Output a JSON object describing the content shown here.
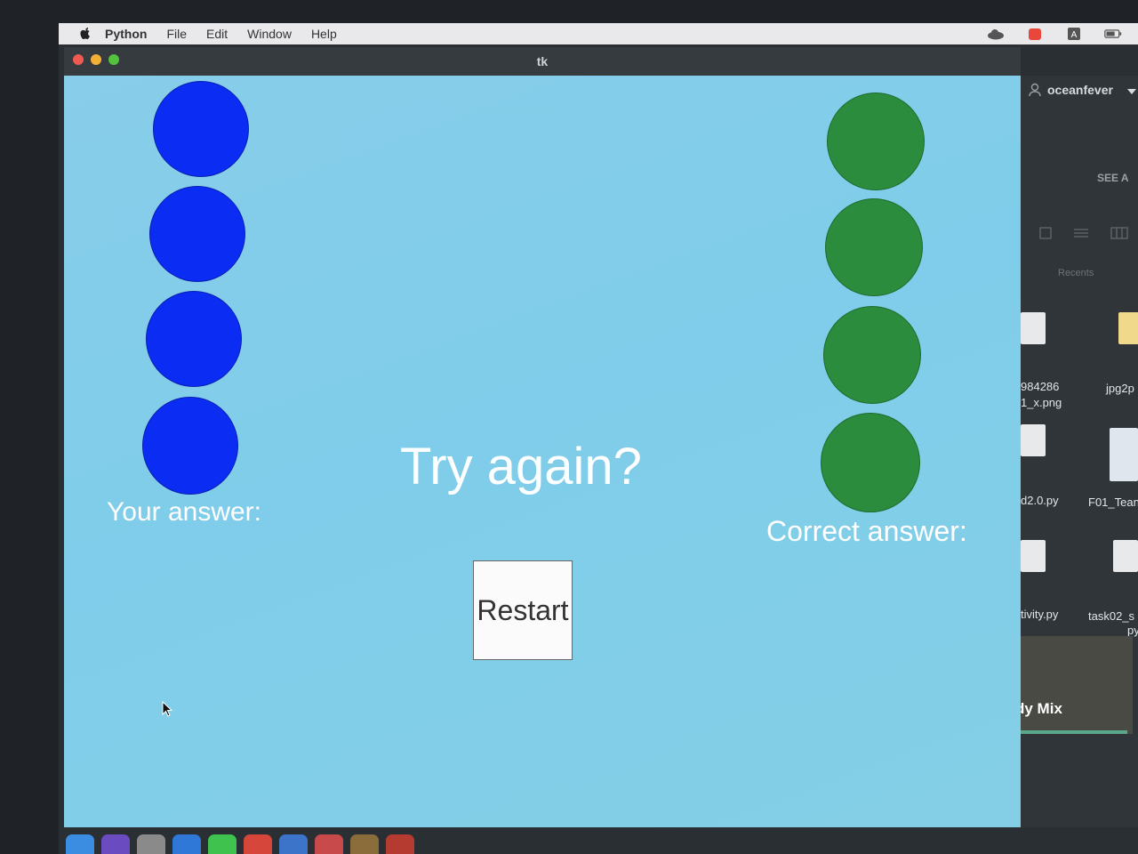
{
  "menubar": {
    "app_name": "Python",
    "items": [
      "File",
      "Edit",
      "Window",
      "Help"
    ]
  },
  "window": {
    "title": "tk"
  },
  "game": {
    "your_answer_label": "Your answer:",
    "correct_answer_label": "Correct answer:",
    "prompt": "Try again?",
    "restart_label": "Restart",
    "your_answer_colors": [
      "#0a2cf3",
      "#0a2cf3",
      "#0a2cf3",
      "#0a2cf3"
    ],
    "correct_answer_colors": [
      "#2b8c3e",
      "#2b8c3e",
      "#2b8c3e",
      "#2b8c3e"
    ],
    "background": "#84cfe8"
  },
  "finder": {
    "user": "oceanfever",
    "see_all": "SEE A",
    "recents": "Recents",
    "files": [
      {
        "name": "984286",
        "name2": "1_x.png"
      },
      {
        "name": "jpg2p"
      },
      {
        "name": "d2.0.py"
      },
      {
        "name": "F01_Tean"
      },
      {
        "name": "tivity.py"
      },
      {
        "name": "task02_s",
        "name2": "py"
      }
    ],
    "playlist": "dy Mix"
  }
}
